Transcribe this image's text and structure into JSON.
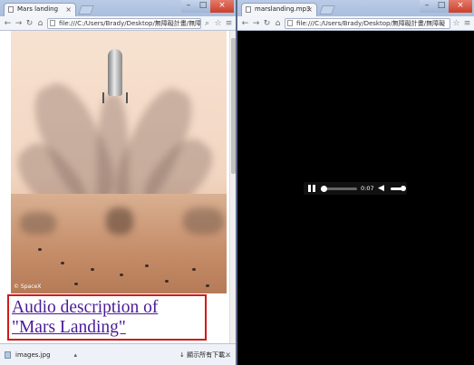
{
  "left_window": {
    "tab_title": "Mars landing",
    "url": "file:///C:/Users/Brady/Desktop/無障礙計畫/無障礙",
    "image_watermark": "© SpaceX",
    "caption_link": "Audio description of \"Mars Landing\"",
    "download": {
      "filename": "images.jpg",
      "show_all": "顯示所有下載...",
      "close": "×"
    }
  },
  "right_window": {
    "tab_title": "marslanding.mp3",
    "url": "file:///C:/Users/Brady/Desktop/無障礙計畫/無障礙",
    "player": {
      "time": "0:07",
      "progress_fraction": 0.05,
      "volume_fraction": 1.0
    }
  },
  "icons": {
    "back": "←",
    "forward": "→",
    "reload": "↻",
    "home": "⌂",
    "zoom": "⌕",
    "star": "☆",
    "menu": "≡",
    "volume": "◀",
    "tab_close": "×",
    "download_arrow": "▴",
    "showall_arrow": "↓"
  }
}
